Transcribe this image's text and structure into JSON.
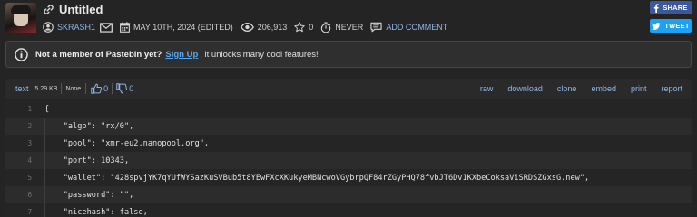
{
  "paste": {
    "title": "Untitled",
    "author": "SKRASH1",
    "date": "MAY 10TH, 2024 (EDITED)",
    "views": "206,913",
    "stars": "0",
    "expiry": "NEVER",
    "add_comment": "ADD COMMENT"
  },
  "share": {
    "facebook_label": "SHARE",
    "twitter_label": "TWEET"
  },
  "notice": {
    "bold_text": "Not a member of Pastebin yet?",
    "link_text": "Sign Up",
    "rest_text": ", it unlocks many cool features!"
  },
  "toolbar": {
    "language": "text",
    "size": "5.29 KB",
    "category": "None",
    "upvotes": "0",
    "downvotes": "0",
    "actions": [
      "raw",
      "download",
      "clone",
      "embed",
      "print",
      "report"
    ]
  },
  "code": {
    "lines": [
      {
        "num": "1.",
        "text": "{"
      },
      {
        "num": "2.",
        "text": "    \"algo\": \"rx/0\","
      },
      {
        "num": "3.",
        "text": "    \"pool\": \"xmr-eu2.nanopool.org\","
      },
      {
        "num": "4.",
        "text": "    \"port\": 10343,"
      },
      {
        "num": "5.",
        "text": "    \"wallet\": \"428spvjYK7qYUfWYSazKuSVBub5t8YEwFXcXKukyeMBNcwoVGybrpQF84rZGyPHQ78fvbJT6Dv1KXbeCoksaViSRDSZGxsG.new\","
      },
      {
        "num": "6.",
        "text": "    \"password\": \"\","
      },
      {
        "num": "7.",
        "text": "    \"nicehash\": false,"
      }
    ]
  },
  "icons": {
    "title": "link-icon",
    "author": "user-icon",
    "message": "envelope-icon",
    "date": "calendar-icon",
    "views": "eye-icon",
    "stars": "star-icon",
    "expiry": "timer-icon",
    "comment": "comment-icon",
    "notice": "info-icon",
    "upvote": "thumbs-up-icon",
    "downvote": "thumbs-down-icon",
    "facebook": "facebook-icon",
    "twitter": "twitter-icon"
  },
  "colors": {
    "background": "#242424",
    "link": "#8fb7e6",
    "facebook": "#3b5998",
    "twitter": "#1da1f2"
  }
}
